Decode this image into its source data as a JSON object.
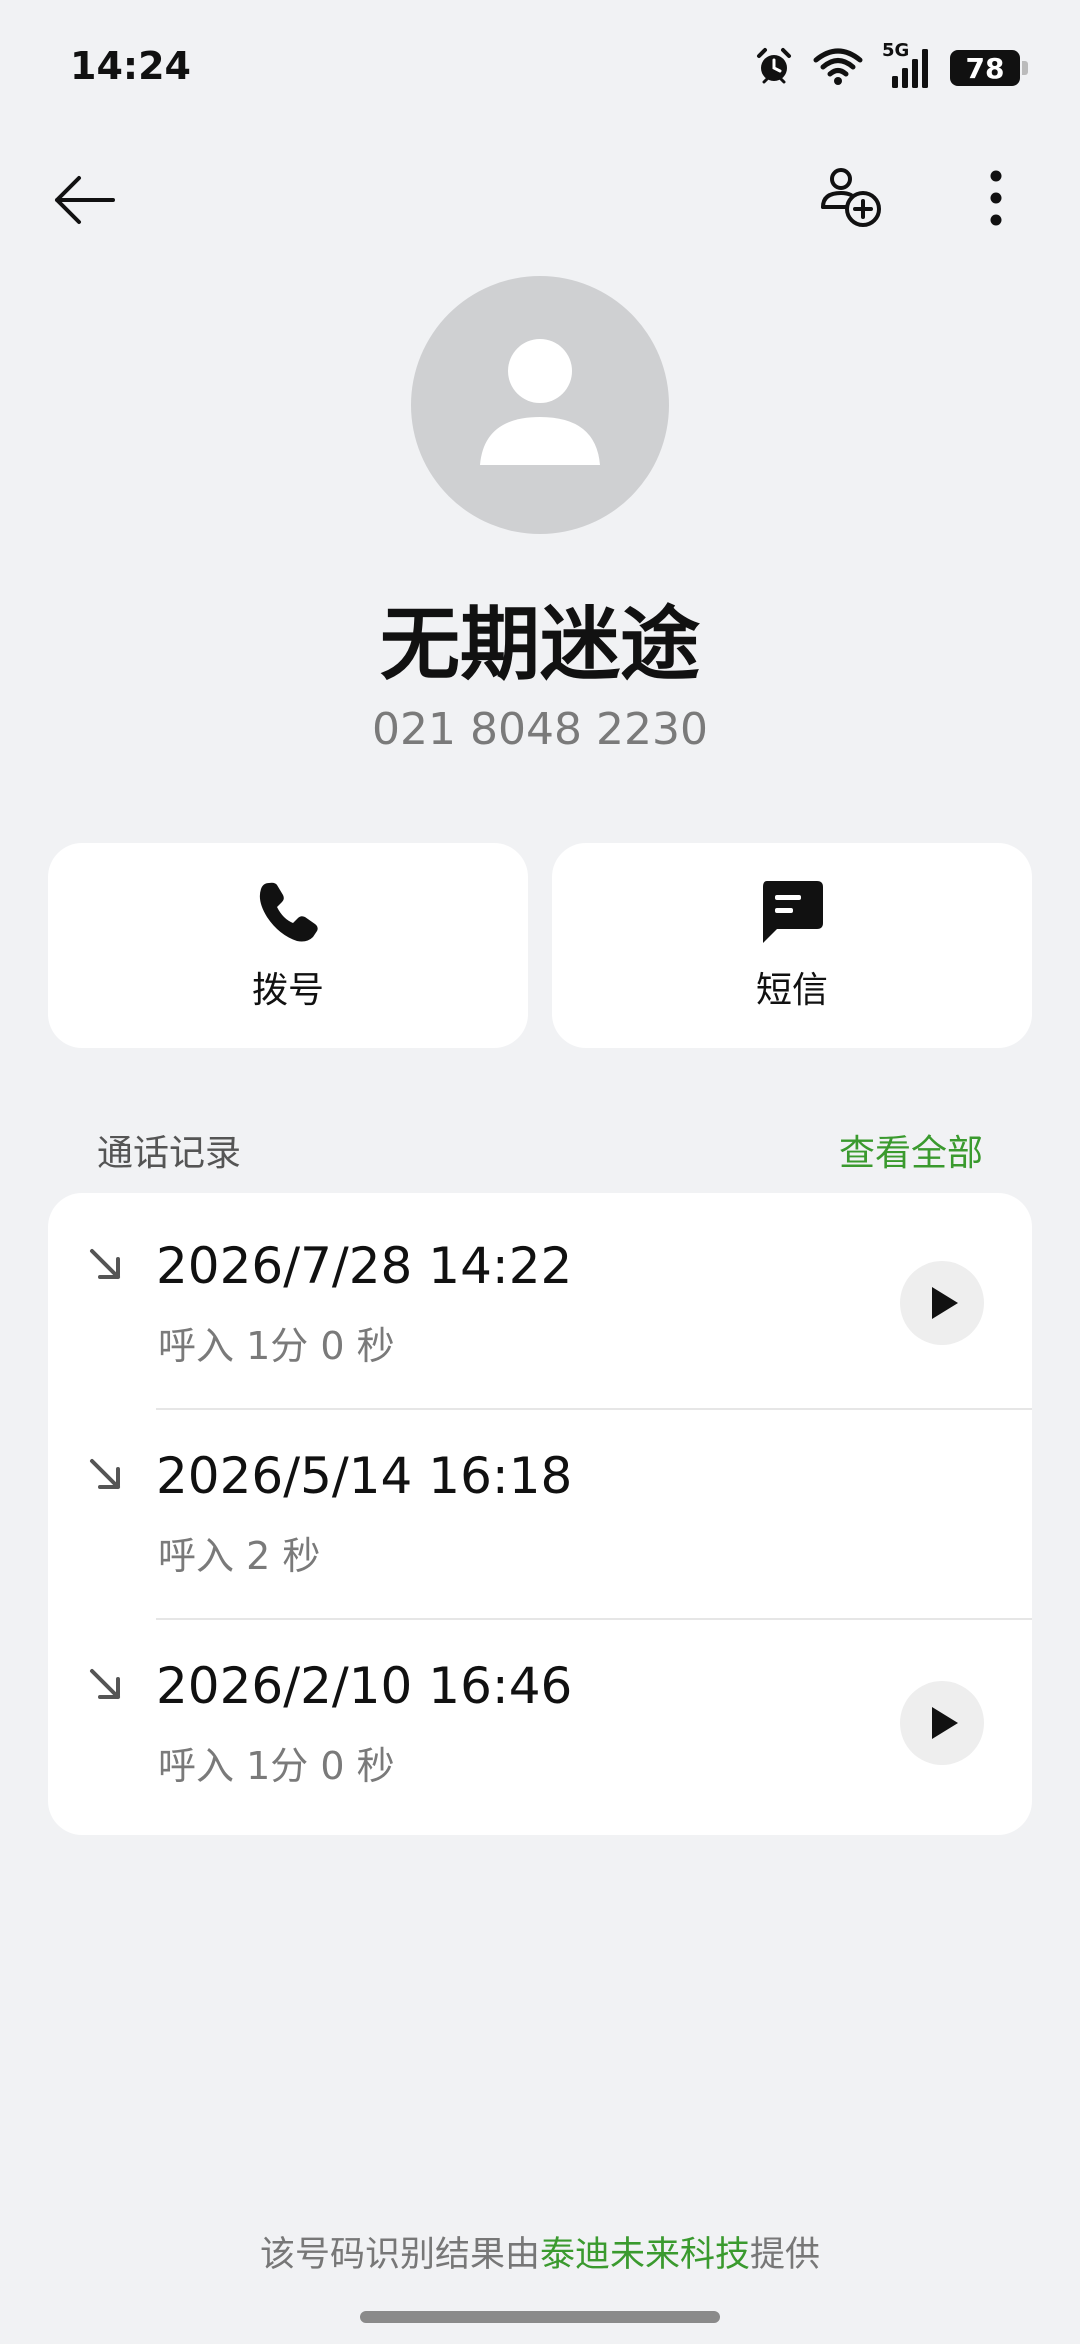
{
  "status_bar": {
    "time": "14:24",
    "network": "5G",
    "battery": "78",
    "icons": [
      "alarm-icon",
      "wifi-icon",
      "cellular-icon",
      "battery-icon"
    ]
  },
  "nav": {
    "icons": [
      "back-arrow-icon",
      "add-contact-icon",
      "more-vertical-icon"
    ]
  },
  "contact": {
    "name": "无期迷途",
    "number": "021 8048 2230",
    "avatar_icon": "person-placeholder-icon"
  },
  "actions": {
    "dial_label": "拨号",
    "sms_label": "短信"
  },
  "call_log": {
    "title": "通话记录",
    "view_all": "查看全部",
    "items": [
      {
        "datetime": "2026/7/28 14:22",
        "detail": "呼入  1分 0 秒",
        "has_recording": true
      },
      {
        "datetime": "2026/5/14 16:18",
        "detail": "呼入  2 秒",
        "has_recording": false
      },
      {
        "datetime": "2026/2/10 16:46",
        "detail": "呼入  1分 0 秒",
        "has_recording": true
      }
    ]
  },
  "footer": {
    "prefix": "该号码识别结果由",
    "brand": "泰迪未来科技",
    "suffix": "提供"
  },
  "colors": {
    "background": "#f1f2f4",
    "accent_green": "#3a9a2e",
    "card": "#ffffff",
    "avatar_bg": "#cfd0d2"
  }
}
